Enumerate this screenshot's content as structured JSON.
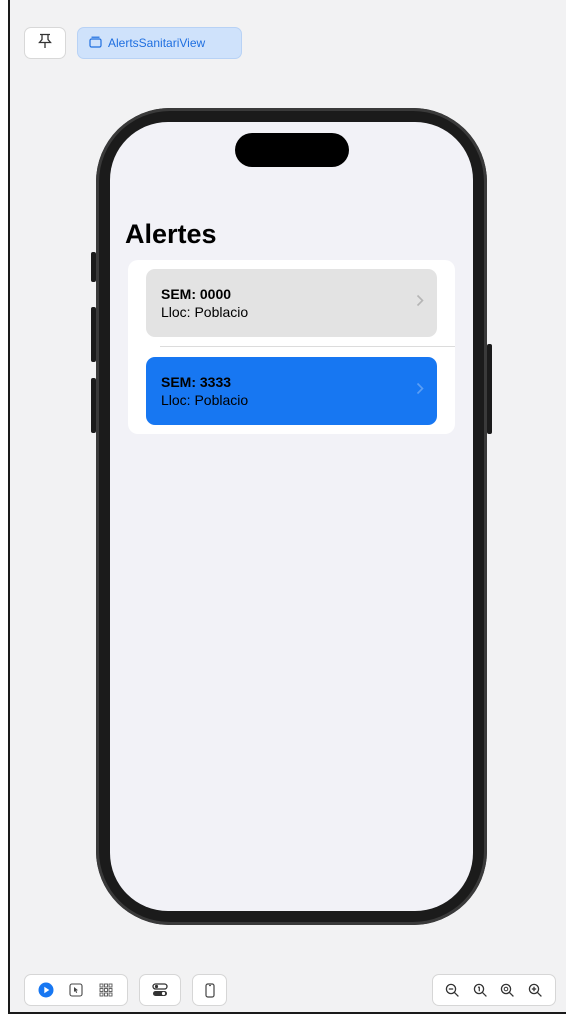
{
  "toolbar": {
    "view_label": "AlertsSanitariView"
  },
  "screen": {
    "title": "Alertes",
    "alerts": [
      {
        "sem": "SEM: 0000",
        "lloc": "Lloc: Poblacio",
        "selected": false
      },
      {
        "sem": "SEM: 3333",
        "lloc": "Lloc: Poblacio",
        "selected": true
      }
    ]
  },
  "colors": {
    "accent": "#1777f2",
    "chip_bg": "#cfe2fb",
    "row_bg": "#e3e3e3",
    "screen_bg": "#f2f2f7"
  },
  "icons": {
    "pin": "pin-icon",
    "view": "rectangle-stack-icon",
    "live": "play-circle-icon",
    "select": "cursor-select-icon",
    "variants": "grid-icon",
    "settings": "toggles-icon",
    "device": "device-icon",
    "zoom_out": "zoom-out-icon",
    "zoom_fit": "zoom-fit-icon",
    "zoom_100": "zoom-actual-icon",
    "zoom_in": "zoom-in-icon"
  }
}
